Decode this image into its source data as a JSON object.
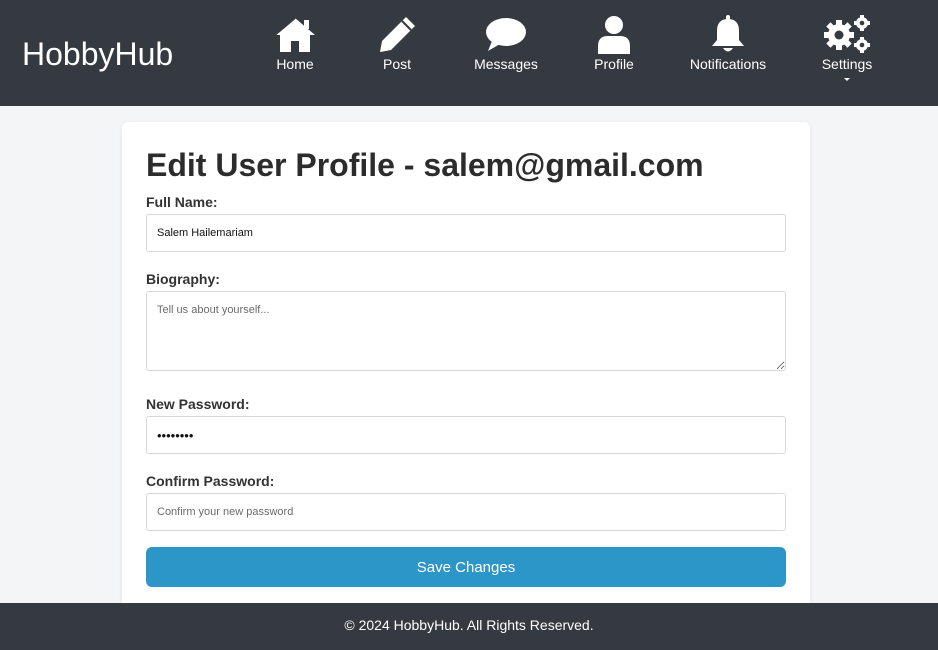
{
  "header": {
    "brand": "HobbyHub",
    "nav": [
      {
        "label": "Home",
        "icon": "home-icon"
      },
      {
        "label": "Post",
        "icon": "pencil-icon"
      },
      {
        "label": "Messages",
        "icon": "chat-bubble-icon"
      },
      {
        "label": "Profile",
        "icon": "user-icon"
      },
      {
        "label": "Notifications",
        "icon": "bell-icon"
      },
      {
        "label": "Settings",
        "icon": "gears-icon"
      }
    ]
  },
  "form": {
    "title": "Edit User Profile - salem@gmail.com",
    "full_name_label": "Full Name:",
    "full_name_value": "Salem Hailemariam",
    "biography_label": "Biography:",
    "biography_placeholder": "Tell us about yourself...",
    "new_password_label": "New Password:",
    "new_password_value": "password",
    "confirm_password_label": "Confirm Password:",
    "confirm_password_placeholder": "Confirm your new password",
    "save_label": "Save Changes"
  },
  "footer": {
    "text": "© 2024 HobbyHub. All Rights Reserved."
  },
  "colors": {
    "header_bg": "#343a40",
    "page_bg": "#f4f5f7",
    "button_bg": "#2d96c9"
  }
}
